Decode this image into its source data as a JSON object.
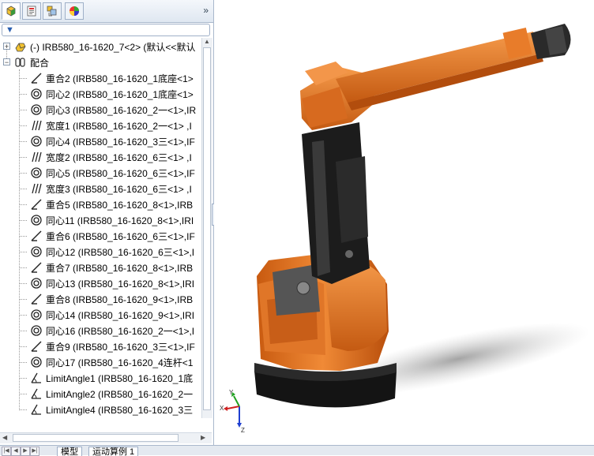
{
  "panel_tabs": [
    {
      "name": "feature-manager-tab",
      "icon": "feature-tree-icon"
    },
    {
      "name": "property-manager-tab",
      "icon": "property-icon"
    },
    {
      "name": "configuration-manager-tab",
      "icon": "configuration-icon"
    },
    {
      "name": "display-manager-tab",
      "icon": "appearance-icon"
    }
  ],
  "collapse_label": "»",
  "tree": {
    "root": {
      "label": "(-) IRB580_16-1620_7<2> (默认<<默认",
      "icon": "part-icon"
    },
    "mates_folder": {
      "label": "配合",
      "icon": "mate-folder-icon"
    },
    "items": [
      {
        "label": "重合2 (IRB580_16-1620_1底座<1>",
        "icon": "coincident-icon"
      },
      {
        "label": "同心2 (IRB580_16-1620_1底座<1>",
        "icon": "concentric-icon"
      },
      {
        "label": "同心3 (IRB580_16-1620_2一<1>,IR",
        "icon": "concentric-icon"
      },
      {
        "label": "宽度1 (IRB580_16-1620_2一<1> ,I",
        "icon": "width-icon"
      },
      {
        "label": "同心4 (IRB580_16-1620_3三<1>,IF",
        "icon": "concentric-icon"
      },
      {
        "label": "宽度2 (IRB580_16-1620_6三<1> ,I",
        "icon": "width-icon"
      },
      {
        "label": "同心5 (IRB580_16-1620_6三<1>,IF",
        "icon": "concentric-icon"
      },
      {
        "label": "宽度3 (IRB580_16-1620_6三<1> ,I",
        "icon": "width-icon"
      },
      {
        "label": "重合5 (IRB580_16-1620_8<1>,IRB",
        "icon": "coincident-icon"
      },
      {
        "label": "同心11 (IRB580_16-1620_8<1>,IRI",
        "icon": "concentric-icon"
      },
      {
        "label": "重合6 (IRB580_16-1620_6三<1>,IF",
        "icon": "coincident-icon"
      },
      {
        "label": "同心12 (IRB580_16-1620_6三<1>,I",
        "icon": "concentric-icon"
      },
      {
        "label": "重合7 (IRB580_16-1620_8<1>,IRB",
        "icon": "coincident-icon"
      },
      {
        "label": "同心13 (IRB580_16-1620_8<1>,IRI",
        "icon": "concentric-icon"
      },
      {
        "label": "重合8 (IRB580_16-1620_9<1>,IRB",
        "icon": "coincident-icon"
      },
      {
        "label": "同心14 (IRB580_16-1620_9<1>,IRI",
        "icon": "concentric-icon"
      },
      {
        "label": "同心16 (IRB580_16-1620_2一<1>,I",
        "icon": "concentric-icon"
      },
      {
        "label": "重合9 (IRB580_16-1620_3三<1>,IF",
        "icon": "coincident-icon"
      },
      {
        "label": "同心17 (IRB580_16-1620_4连杆<1",
        "icon": "concentric-icon"
      },
      {
        "label": "LimitAngle1 (IRB580_16-1620_1底",
        "icon": "limit-angle-icon"
      },
      {
        "label": "LimitAngle2 (IRB580_16-1620_2一",
        "icon": "limit-angle-icon"
      },
      {
        "label": "LimitAngle4 (IRB580_16-1620_3三",
        "icon": "limit-angle-icon"
      }
    ]
  },
  "bottom_tabs": [
    "模型",
    "运动算例 1"
  ],
  "triad": {
    "x": "X",
    "y": "Y",
    "z": "Z"
  },
  "colors": {
    "robot_orange": "#e8731e",
    "robot_black": "#1a1a1a",
    "panel_border": "#a9b8cc"
  }
}
